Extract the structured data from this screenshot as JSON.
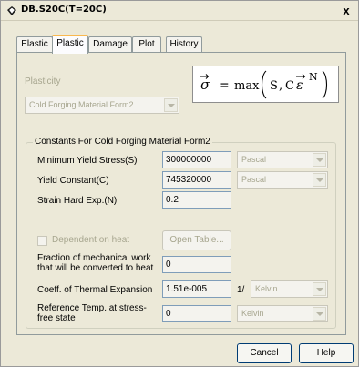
{
  "window": {
    "title": "DB.S20C(T=20C)",
    "close_label": "x"
  },
  "tabs": [
    {
      "label": "Elastic",
      "active": false
    },
    {
      "label": "Plastic",
      "active": true
    },
    {
      "label": "Damage",
      "active": false
    },
    {
      "label": "Plot",
      "active": false
    },
    {
      "label": "History",
      "active": false
    }
  ],
  "plasticity": {
    "label": "Plasticity",
    "selected": "Cold Forging Material Form2",
    "formula": {
      "lhs": "σ",
      "eq": "=",
      "fn": "max",
      "s": "S",
      "comma": ",",
      "c": "C",
      "eps": "ε",
      "exp": "N"
    }
  },
  "constants": {
    "title": "Constants For Cold Forging Material Form2",
    "min_yield_label": "Minimum Yield Stress(S)",
    "min_yield_value": "300000000",
    "min_yield_unit": "Pascal",
    "yield_const_label": "Yield Constant(C)",
    "yield_const_value": "745320000",
    "yield_const_unit": "Pascal",
    "strain_hard_label": "Strain Hard Exp.(N)",
    "strain_hard_value": "0.2",
    "dependent_on_heat_label": "Dependent on heat",
    "open_table_label": "Open Table...",
    "fraction_label_line1": "Fraction  of mechanical work",
    "fraction_label_line2": "that will be converted to heat",
    "fraction_value": "0",
    "thermal_exp_label": "Coeff. of Thermal Expansion",
    "thermal_exp_value": "1.51e-005",
    "thermal_exp_prefix": "1/",
    "thermal_exp_unit": "Kelvin",
    "ref_temp_label_line1": "Reference Temp. at stress-",
    "ref_temp_label_line2": "free state",
    "ref_temp_value": "0",
    "ref_temp_unit": "Kelvin"
  },
  "footer": {
    "cancel_label": "Cancel",
    "help_label": "Help"
  }
}
